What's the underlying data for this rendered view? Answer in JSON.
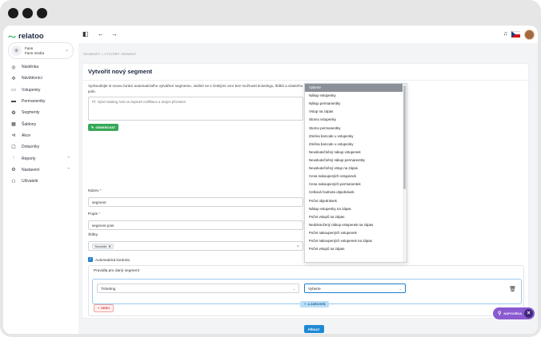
{
  "brand": {
    "name": "relatoo"
  },
  "account": {
    "line1": "Fans",
    "line2": "Fans media"
  },
  "sidebar": {
    "items": [
      {
        "label": "Nástěnka",
        "icon": "dashboard-icon",
        "glyph": "◎"
      },
      {
        "label": "Návštěvníci",
        "icon": "visitors-icon",
        "glyph": "✣"
      },
      {
        "label": "Vstupenky",
        "icon": "ticket-icon",
        "glyph": "▭"
      },
      {
        "label": "Permanentky",
        "icon": "card-icon",
        "glyph": "▬"
      },
      {
        "label": "Segmenty",
        "icon": "segments-icon",
        "glyph": "❂"
      },
      {
        "label": "Šablony",
        "icon": "templates-icon",
        "glyph": "▦"
      },
      {
        "label": "Akce",
        "icon": "megaphone-icon",
        "glyph": "⊲"
      },
      {
        "label": "Dotazníky",
        "icon": "survey-icon",
        "glyph": "☐"
      },
      {
        "label": "Reporty",
        "icon": "chart-icon",
        "glyph": "⫶",
        "caret": "⌃"
      },
      {
        "label": "Nastavení",
        "icon": "gear-icon",
        "glyph": "⚙",
        "caret": "⌃"
      },
      {
        "label": "Uživatelé",
        "icon": "users-icon",
        "glyph": "⚇"
      }
    ]
  },
  "breadcrumb": "SEGMENTY > VYTVOŘIT SEGMENT",
  "page": {
    "title": "Vytvořit nový segment",
    "description": "Vyzkoušejte si novou funkci automatického vytváření segmentu. Jediné se s českými vzor bez možnosti ticketingu, štítků a vlastního pole.",
    "ai_placeholder": "Př. Vyber katalog, kdo na zapnuté notifikace a dvojen přiznaten",
    "generate_label": "GENEROVAT"
  },
  "form": {
    "name_label": "Název",
    "name_value": "segment",
    "desc_label": "Popis",
    "desc_value": "segment pois",
    "tags_label": "Štítky",
    "tag_value": "Timoddle",
    "auto_control_label": "Automatická kontrola"
  },
  "rules": {
    "title": "Pravidla pro daný segment",
    "field1_value": "Ticketing",
    "field2_value": "Vyberte",
    "or_label": "NEBO",
    "and_label": "A ZÁROVEŇ",
    "submit_label": "PŘIDAT"
  },
  "dropdown": {
    "options": [
      "Vyberte",
      "Nákup vstupenky",
      "Nákup permanentky",
      "Vstup na zápas",
      "Storno vstupenky",
      "Storno permanentky",
      "Změna barcode u vstupenky",
      "Změna barcode u vstupenky",
      "Neuskutečněný nákup vstupenek",
      "Neuskutečněný nákup permanentky",
      "Neuskutečněný vstup na zápas",
      "Cena nakoupených vstupenek",
      "Cena nakoupených permanentek",
      "Celková hodnota objednávek",
      "Počet objednávek",
      "Nákup vstupenky na zápas",
      "Počet vstupů na zápas",
      "Nedokončený nákup vstupenek na zápas",
      "Počet nakoupených vstupenek",
      "Počet nakoupených vstupenek na zápas",
      "Počet vstupů na zápas"
    ]
  },
  "help": {
    "label": "NÁPOVĚDA"
  },
  "colors": {
    "accent": "#1f8ad6",
    "brand_green": "#35b463",
    "help_purple": "#8a5ad0"
  }
}
